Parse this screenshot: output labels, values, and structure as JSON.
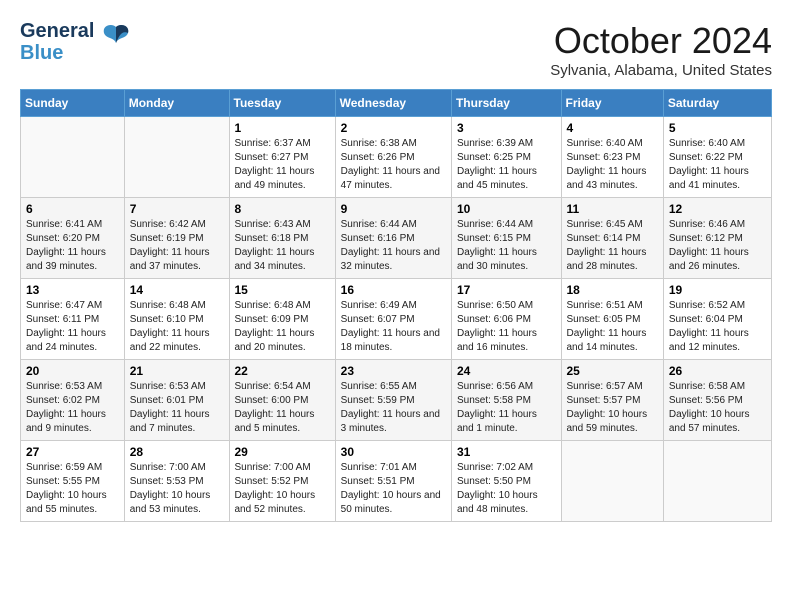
{
  "header": {
    "logo_line1": "General",
    "logo_line2": "Blue",
    "month_title": "October 2024",
    "location": "Sylvania, Alabama, United States"
  },
  "days_of_week": [
    "Sunday",
    "Monday",
    "Tuesday",
    "Wednesday",
    "Thursday",
    "Friday",
    "Saturday"
  ],
  "weeks": [
    [
      {
        "day": "",
        "info": ""
      },
      {
        "day": "",
        "info": ""
      },
      {
        "day": "1",
        "info": "Sunrise: 6:37 AM\nSunset: 6:27 PM\nDaylight: 11 hours and 49 minutes."
      },
      {
        "day": "2",
        "info": "Sunrise: 6:38 AM\nSunset: 6:26 PM\nDaylight: 11 hours and 47 minutes."
      },
      {
        "day": "3",
        "info": "Sunrise: 6:39 AM\nSunset: 6:25 PM\nDaylight: 11 hours and 45 minutes."
      },
      {
        "day": "4",
        "info": "Sunrise: 6:40 AM\nSunset: 6:23 PM\nDaylight: 11 hours and 43 minutes."
      },
      {
        "day": "5",
        "info": "Sunrise: 6:40 AM\nSunset: 6:22 PM\nDaylight: 11 hours and 41 minutes."
      }
    ],
    [
      {
        "day": "6",
        "info": "Sunrise: 6:41 AM\nSunset: 6:20 PM\nDaylight: 11 hours and 39 minutes."
      },
      {
        "day": "7",
        "info": "Sunrise: 6:42 AM\nSunset: 6:19 PM\nDaylight: 11 hours and 37 minutes."
      },
      {
        "day": "8",
        "info": "Sunrise: 6:43 AM\nSunset: 6:18 PM\nDaylight: 11 hours and 34 minutes."
      },
      {
        "day": "9",
        "info": "Sunrise: 6:44 AM\nSunset: 6:16 PM\nDaylight: 11 hours and 32 minutes."
      },
      {
        "day": "10",
        "info": "Sunrise: 6:44 AM\nSunset: 6:15 PM\nDaylight: 11 hours and 30 minutes."
      },
      {
        "day": "11",
        "info": "Sunrise: 6:45 AM\nSunset: 6:14 PM\nDaylight: 11 hours and 28 minutes."
      },
      {
        "day": "12",
        "info": "Sunrise: 6:46 AM\nSunset: 6:12 PM\nDaylight: 11 hours and 26 minutes."
      }
    ],
    [
      {
        "day": "13",
        "info": "Sunrise: 6:47 AM\nSunset: 6:11 PM\nDaylight: 11 hours and 24 minutes."
      },
      {
        "day": "14",
        "info": "Sunrise: 6:48 AM\nSunset: 6:10 PM\nDaylight: 11 hours and 22 minutes."
      },
      {
        "day": "15",
        "info": "Sunrise: 6:48 AM\nSunset: 6:09 PM\nDaylight: 11 hours and 20 minutes."
      },
      {
        "day": "16",
        "info": "Sunrise: 6:49 AM\nSunset: 6:07 PM\nDaylight: 11 hours and 18 minutes."
      },
      {
        "day": "17",
        "info": "Sunrise: 6:50 AM\nSunset: 6:06 PM\nDaylight: 11 hours and 16 minutes."
      },
      {
        "day": "18",
        "info": "Sunrise: 6:51 AM\nSunset: 6:05 PM\nDaylight: 11 hours and 14 minutes."
      },
      {
        "day": "19",
        "info": "Sunrise: 6:52 AM\nSunset: 6:04 PM\nDaylight: 11 hours and 12 minutes."
      }
    ],
    [
      {
        "day": "20",
        "info": "Sunrise: 6:53 AM\nSunset: 6:02 PM\nDaylight: 11 hours and 9 minutes."
      },
      {
        "day": "21",
        "info": "Sunrise: 6:53 AM\nSunset: 6:01 PM\nDaylight: 11 hours and 7 minutes."
      },
      {
        "day": "22",
        "info": "Sunrise: 6:54 AM\nSunset: 6:00 PM\nDaylight: 11 hours and 5 minutes."
      },
      {
        "day": "23",
        "info": "Sunrise: 6:55 AM\nSunset: 5:59 PM\nDaylight: 11 hours and 3 minutes."
      },
      {
        "day": "24",
        "info": "Sunrise: 6:56 AM\nSunset: 5:58 PM\nDaylight: 11 hours and 1 minute."
      },
      {
        "day": "25",
        "info": "Sunrise: 6:57 AM\nSunset: 5:57 PM\nDaylight: 10 hours and 59 minutes."
      },
      {
        "day": "26",
        "info": "Sunrise: 6:58 AM\nSunset: 5:56 PM\nDaylight: 10 hours and 57 minutes."
      }
    ],
    [
      {
        "day": "27",
        "info": "Sunrise: 6:59 AM\nSunset: 5:55 PM\nDaylight: 10 hours and 55 minutes."
      },
      {
        "day": "28",
        "info": "Sunrise: 7:00 AM\nSunset: 5:53 PM\nDaylight: 10 hours and 53 minutes."
      },
      {
        "day": "29",
        "info": "Sunrise: 7:00 AM\nSunset: 5:52 PM\nDaylight: 10 hours and 52 minutes."
      },
      {
        "day": "30",
        "info": "Sunrise: 7:01 AM\nSunset: 5:51 PM\nDaylight: 10 hours and 50 minutes."
      },
      {
        "day": "31",
        "info": "Sunrise: 7:02 AM\nSunset: 5:50 PM\nDaylight: 10 hours and 48 minutes."
      },
      {
        "day": "",
        "info": ""
      },
      {
        "day": "",
        "info": ""
      }
    ]
  ]
}
